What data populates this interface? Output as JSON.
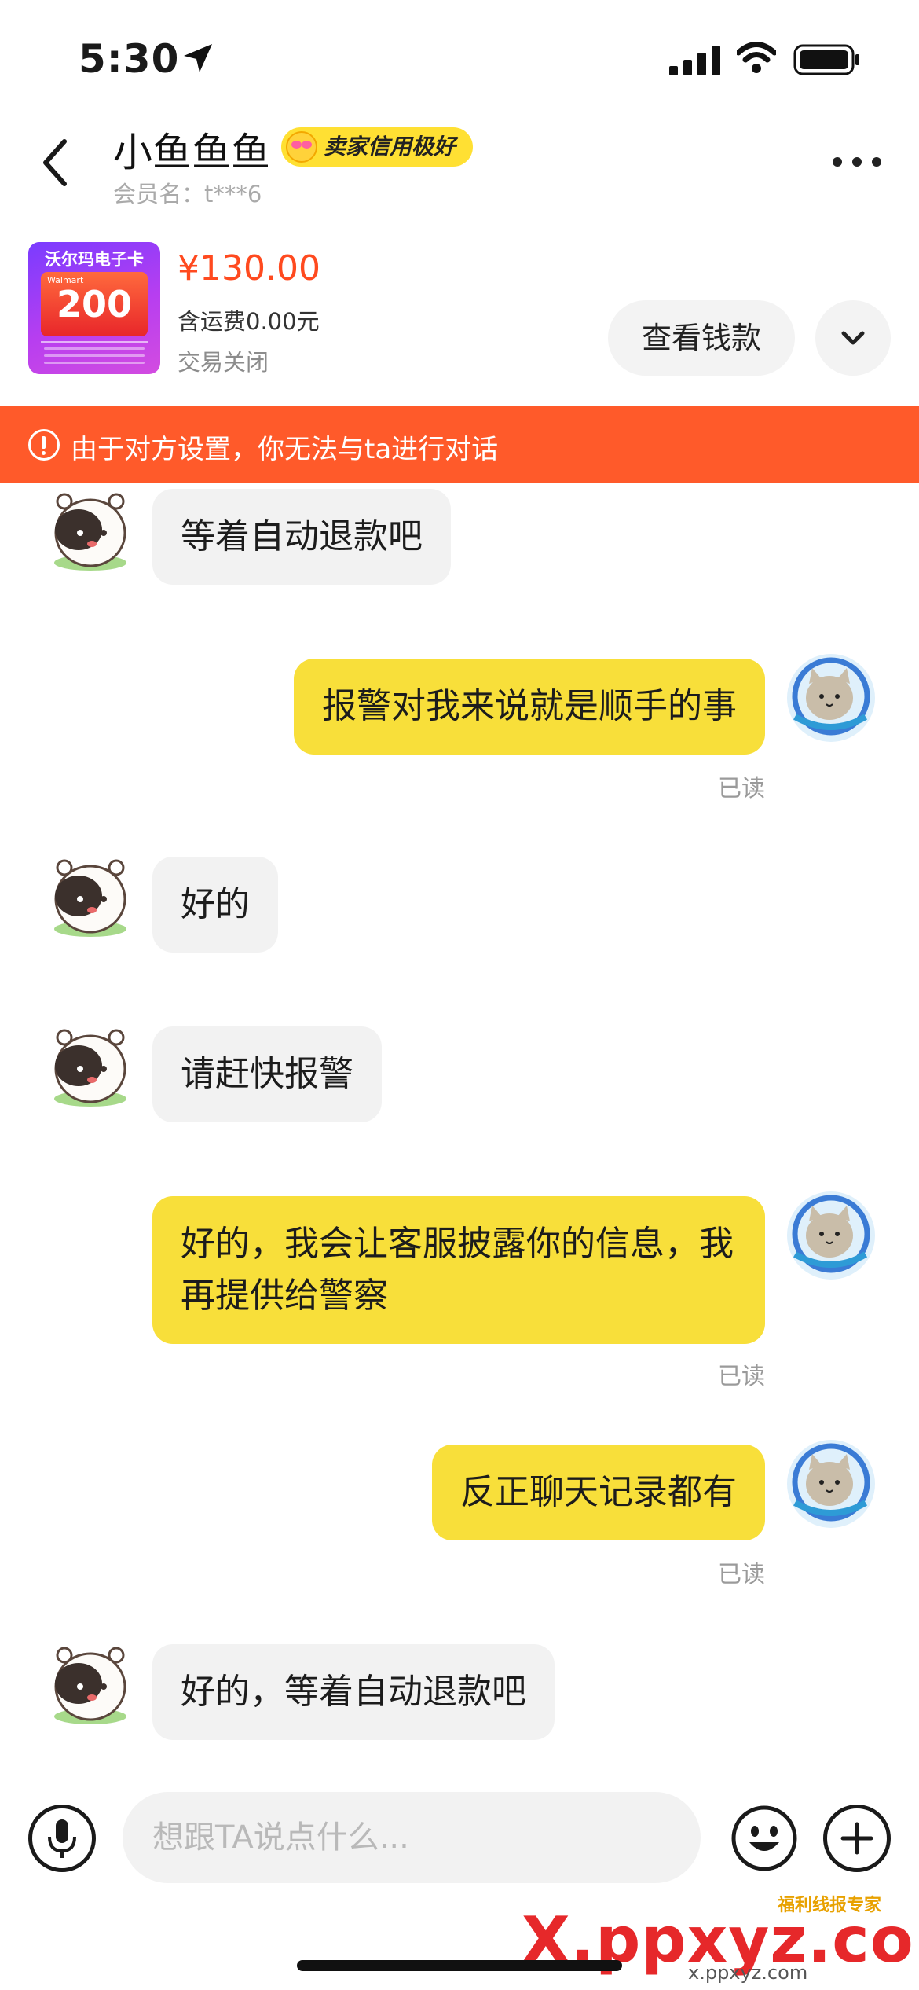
{
  "status_bar": {
    "time": "5:30"
  },
  "header": {
    "title": "小鱼鱼鱼",
    "credit_badge": "卖家信用极好",
    "member_name": "会员名：t***6"
  },
  "product": {
    "image_title": "沃尔玛电子卡",
    "image_brand": "Walmart",
    "image_amount": "200",
    "price": "¥130.00",
    "shipping": "含运费0.00元",
    "status": "交易关闭",
    "view_button": "查看钱款"
  },
  "banner": {
    "text": "由于对方设置，你无法与ta进行对话"
  },
  "messages": [
    {
      "side": "left",
      "text": "等着自动退款吧"
    },
    {
      "side": "right",
      "text": "报警对我来说就是顺手的事",
      "read": "已读"
    },
    {
      "side": "left",
      "text": "好的"
    },
    {
      "side": "left",
      "text": "请赶快报警"
    },
    {
      "side": "right",
      "text": "好的，我会让客服披露你的信息，我再提供给警察",
      "read": "已读"
    },
    {
      "side": "right",
      "text": "反正聊天记录都有",
      "read": "已读"
    },
    {
      "side": "left",
      "text": "好的，等着自动退款吧"
    }
  ],
  "input": {
    "placeholder": "想跟TA说点什么..."
  },
  "watermark": {
    "tag": "福利线报专家",
    "main": "X.ppxyz.com",
    "sub": "x.ppxyz.com"
  },
  "colors": {
    "banner": "#ff5a2a",
    "own_bubble": "#f8df3a",
    "other_bubble": "#f2f2f2",
    "price": "#ff4a1f",
    "badge": "#ffe033"
  }
}
